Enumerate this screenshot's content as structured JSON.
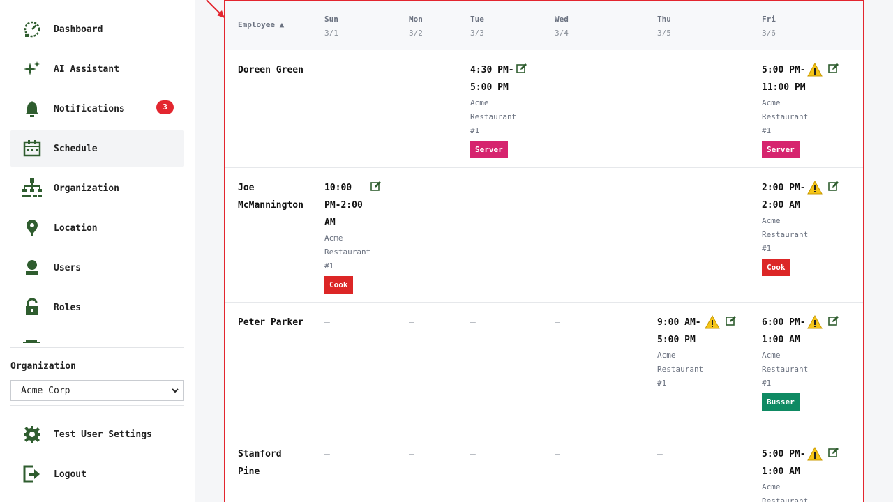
{
  "sidebar": {
    "items": [
      {
        "label": "Dashboard",
        "icon": "dashboard-icon"
      },
      {
        "label": "AI Assistant",
        "icon": "sparkle-icon"
      },
      {
        "label": "Notifications",
        "icon": "bell-icon",
        "badge": "3"
      },
      {
        "label": "Schedule",
        "icon": "calendar-icon",
        "active": true
      },
      {
        "label": "Organization",
        "icon": "org-chart-icon"
      },
      {
        "label": "Location",
        "icon": "location-pin-icon"
      },
      {
        "label": "Users",
        "icon": "user-icon"
      },
      {
        "label": "Roles",
        "icon": "lock-icon"
      }
    ],
    "org_label": "Organization",
    "org_value": "Acme Corp",
    "bottom_items": [
      {
        "label": "Test User Settings",
        "icon": "gear-icon"
      },
      {
        "label": "Logout",
        "icon": "logout-icon"
      }
    ]
  },
  "colors": {
    "accent_green": "#2f5d2f",
    "badge_red": "#e3262f",
    "server": "#d6246e",
    "cook": "#dc2626",
    "busser": "#0f8a63",
    "warning": "#f5c518"
  },
  "table": {
    "employee_header": "Employee ▲",
    "days": [
      {
        "name": "Sun",
        "date": "3/1"
      },
      {
        "name": "Mon",
        "date": "3/2"
      },
      {
        "name": "Tue",
        "date": "3/3"
      },
      {
        "name": "Wed",
        "date": "3/4"
      },
      {
        "name": "Thu",
        "date": "3/5"
      },
      {
        "name": "Fri",
        "date": "3/6"
      }
    ],
    "empty": "—",
    "rows": [
      {
        "employee": [
          "Doreen Green"
        ],
        "shifts": {
          "Tue": {
            "time": [
              "4:30 PM-",
              "5:00 PM"
            ],
            "location": [
              "Acme",
              "Restaurant",
              "#1"
            ],
            "role": "Server",
            "warning": false
          },
          "Fri": {
            "time": [
              "5:00 PM-",
              "11:00 PM"
            ],
            "location": [
              "Acme",
              "Restaurant",
              "#1"
            ],
            "role": "Server",
            "warning": true
          }
        }
      },
      {
        "employee": [
          "Joe",
          "McMannington"
        ],
        "shifts": {
          "Sun": {
            "time": [
              "10:00",
              "PM-2:00",
              "AM"
            ],
            "location": [
              "Acme",
              "Restaurant",
              "#1"
            ],
            "role": "Cook",
            "warning": false
          },
          "Fri": {
            "time": [
              "2:00 PM-",
              "2:00 AM"
            ],
            "location": [
              "Acme",
              "Restaurant",
              "#1"
            ],
            "role": "Cook",
            "warning": true
          }
        }
      },
      {
        "employee": [
          "Peter Parker"
        ],
        "shifts": {
          "Thu": {
            "time": [
              "9:00 AM-",
              "5:00 PM"
            ],
            "location": [
              "Acme",
              "Restaurant",
              "#1"
            ],
            "role": "",
            "warning": true
          },
          "Fri": {
            "time": [
              "6:00 PM-",
              "1:00 AM"
            ],
            "location": [
              "Acme",
              "Restaurant",
              "#1"
            ],
            "role": "Busser",
            "warning": true
          }
        }
      },
      {
        "employee": [
          "Stanford",
          "Pine"
        ],
        "shifts": {
          "Fri": {
            "time": [
              "5:00 PM-",
              "1:00 AM"
            ],
            "location": [
              "Acme",
              "Restaurant"
            ],
            "role": "",
            "warning": true
          }
        }
      }
    ]
  }
}
